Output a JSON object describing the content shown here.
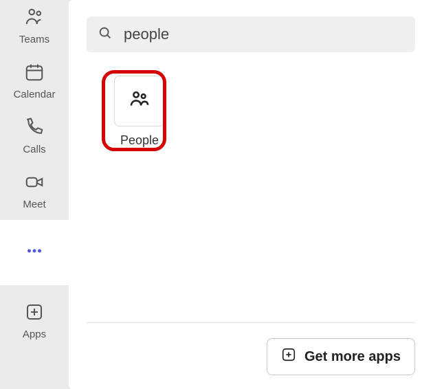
{
  "sidebar": {
    "items": {
      "teams": {
        "label": "Teams"
      },
      "calendar": {
        "label": "Calendar"
      },
      "calls": {
        "label": "Calls"
      },
      "meet": {
        "label": "Meet"
      },
      "apps": {
        "label": "Apps"
      }
    }
  },
  "search": {
    "value": "people"
  },
  "results": {
    "people_app": {
      "label": "People"
    }
  },
  "footer": {
    "get_more": "Get more apps"
  }
}
